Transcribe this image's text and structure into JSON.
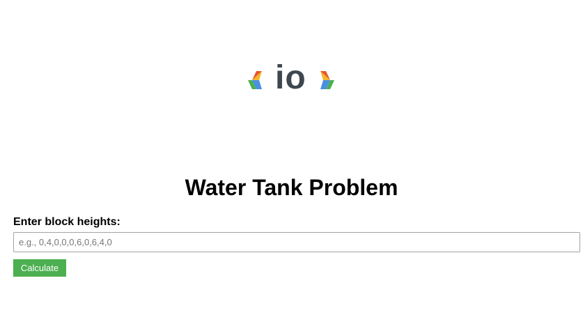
{
  "logo": {
    "text": "io",
    "left_icon": "chevron-left-icon",
    "right_icon": "chevron-right-icon",
    "colors": [
      "#e8562a",
      "#4caf50",
      "#4a90e2",
      "#f5b62a"
    ]
  },
  "main": {
    "title": "Water Tank Problem",
    "input_label": "Enter block heights:",
    "input_placeholder": "e.g., 0,4,0,0,0,6,0,6,4,0",
    "input_value": "",
    "button_label": "Calculate"
  },
  "colors": {
    "button_bg": "#4caf50",
    "button_text": "#ffffff",
    "logo_text": "#3e474f"
  }
}
